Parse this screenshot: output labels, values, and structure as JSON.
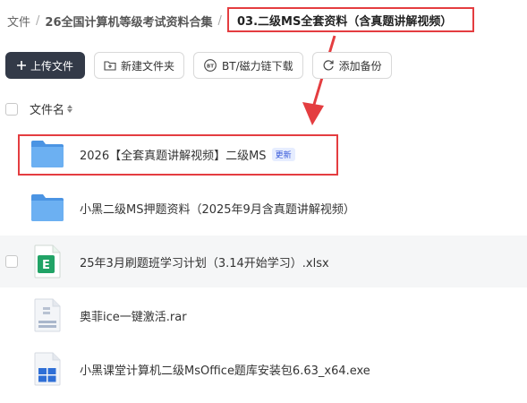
{
  "breadcrumb": {
    "items": [
      "文件",
      "26全国计算机等级考试资料合集"
    ],
    "separator": "/",
    "current": "03.二级MS全套资料（含真题讲解视频）"
  },
  "toolbar": {
    "upload": "上传文件",
    "new_folder": "新建文件夹",
    "bt": "BT/磁力链下载",
    "backup": "添加备份"
  },
  "list": {
    "header": "文件名",
    "files": [
      {
        "name": "2026【全套真题讲解视频】二级MS",
        "badge": "更新",
        "icon": "folder-icon"
      },
      {
        "name": "小黑二级MS押题资料（2025年9月含真题讲解视频）",
        "icon": "folder-icon"
      },
      {
        "name": "25年3月刷题班学习计划（3.14开始学习）.xlsx",
        "icon": "excel-file-icon"
      },
      {
        "name": "奥菲ice一键激活.rar",
        "icon": "rar-file-icon"
      },
      {
        "name": "小黑课堂计算机二级MsOffice题库安装包6.63_x64.exe",
        "icon": "exe-file-icon"
      }
    ]
  },
  "colors": {
    "accent_red": "#e43d40",
    "primary_button": "#333a48",
    "folder_blue": "#5aa2ec",
    "excel_green": "#21a366",
    "badge_blue": "#3a5bd9"
  }
}
